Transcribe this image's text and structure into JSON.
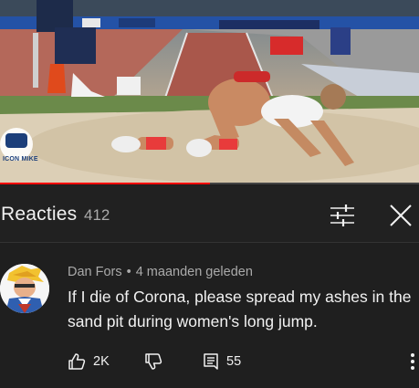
{
  "video": {
    "watermark_text": "ICON MIKE",
    "progress": 0.5
  },
  "comments_header": {
    "title": "Reacties",
    "count": "412",
    "filter_icon": "sort-filter-icon",
    "close_icon": "close-icon"
  },
  "comment": {
    "author": "Dan Fors",
    "separator": "•",
    "time": "4 maanden geleden",
    "text": "If I die of Corona, please spread my ashes in the sand pit during women's long jump.",
    "likes": "2K",
    "replies": "55",
    "icons": {
      "like": "thumbs-up-icon",
      "dislike": "thumbs-down-icon",
      "reply": "comment-replies-icon",
      "more": "more-vertical-icon"
    }
  },
  "colors": {
    "background": "#1f1f1f",
    "primary_text": "#f1f1f1",
    "secondary_text": "#aaaaaa",
    "progress": "#ff0000"
  }
}
